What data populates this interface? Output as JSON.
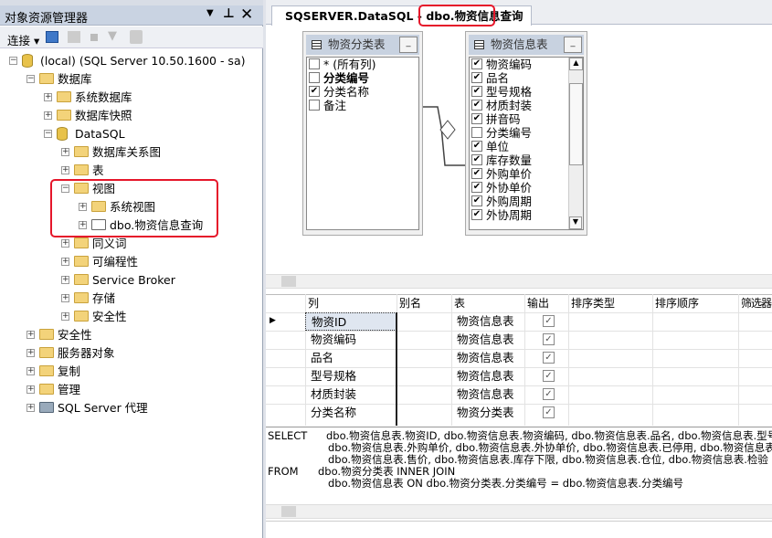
{
  "explorer": {
    "title": "对象资源管理器",
    "connect_label": "连接",
    "tree": [
      {
        "label": "(local) (SQL Server 10.50.1600 - sa)",
        "level": 0,
        "expanded": true,
        "icon": "server-icon"
      },
      {
        "label": "数据库",
        "level": 1,
        "expanded": true,
        "icon": "folder-icon"
      },
      {
        "label": "系统数据库",
        "level": 2,
        "expanded": false,
        "icon": "folder-icon"
      },
      {
        "label": "数据库快照",
        "level": 2,
        "expanded": false,
        "icon": "folder-icon"
      },
      {
        "label": "DataSQL",
        "level": 2,
        "expanded": true,
        "icon": "database-icon"
      },
      {
        "label": "数据库关系图",
        "level": 3,
        "expanded": false,
        "icon": "folder-icon"
      },
      {
        "label": "表",
        "level": 3,
        "expanded": false,
        "icon": "folder-icon"
      },
      {
        "label": "视图",
        "level": 3,
        "expanded": true,
        "icon": "folder-icon"
      },
      {
        "label": "系统视图",
        "level": 4,
        "expanded": false,
        "icon": "folder-icon"
      },
      {
        "label": "dbo.物资信息查询",
        "level": 4,
        "expanded": false,
        "icon": "view-icon"
      },
      {
        "label": "同义词",
        "level": 3,
        "expanded": false,
        "icon": "folder-icon"
      },
      {
        "label": "可编程性",
        "level": 3,
        "expanded": false,
        "icon": "folder-icon"
      },
      {
        "label": "Service Broker",
        "level": 3,
        "expanded": false,
        "icon": "folder-icon"
      },
      {
        "label": "存储",
        "level": 3,
        "expanded": false,
        "icon": "folder-icon"
      },
      {
        "label": "安全性",
        "level": 3,
        "expanded": false,
        "icon": "folder-icon"
      },
      {
        "label": "安全性",
        "level": 1,
        "expanded": false,
        "icon": "folder-icon"
      },
      {
        "label": "服务器对象",
        "level": 1,
        "expanded": false,
        "icon": "folder-icon"
      },
      {
        "label": "复制",
        "level": 1,
        "expanded": false,
        "icon": "folder-icon"
      },
      {
        "label": "管理",
        "level": 1,
        "expanded": false,
        "icon": "folder-icon"
      },
      {
        "label": "SQL Server 代理",
        "level": 1,
        "expanded": false,
        "icon": "agent-icon"
      }
    ]
  },
  "tab": {
    "title": "SQSERVER.DataSQL - dbo.物资信息查询"
  },
  "diagram": {
    "tables": [
      {
        "name": "物资分类表",
        "columns": [
          {
            "name": "* (所有列)",
            "checked": false,
            "bold": false
          },
          {
            "name": "分类编号",
            "checked": false,
            "bold": true
          },
          {
            "name": "分类名称",
            "checked": true,
            "bold": false
          },
          {
            "name": "备注",
            "checked": false,
            "bold": false
          }
        ]
      },
      {
        "name": "物资信息表",
        "columns": [
          {
            "name": "物资编码",
            "checked": true
          },
          {
            "name": "品名",
            "checked": true
          },
          {
            "name": "型号规格",
            "checked": true
          },
          {
            "name": "材质封装",
            "checked": true
          },
          {
            "name": "拼音码",
            "checked": true
          },
          {
            "name": "分类编号",
            "checked": false
          },
          {
            "name": "单位",
            "checked": true
          },
          {
            "name": "库存数量",
            "checked": true
          },
          {
            "name": "外购单价",
            "checked": true
          },
          {
            "name": "外协单价",
            "checked": true
          },
          {
            "name": "外购周期",
            "checked": true
          },
          {
            "name": "外协周期",
            "checked": true
          }
        ]
      }
    ]
  },
  "grid": {
    "headers": [
      "列",
      "别名",
      "表",
      "输出",
      "排序类型",
      "排序顺序",
      "筛选器"
    ],
    "rows": [
      {
        "column": "物资ID",
        "alias": "",
        "table": "物资信息表",
        "output": true
      },
      {
        "column": "物资编码",
        "alias": "",
        "table": "物资信息表",
        "output": true
      },
      {
        "column": "品名",
        "alias": "",
        "table": "物资信息表",
        "output": true
      },
      {
        "column": "型号规格",
        "alias": "",
        "table": "物资信息表",
        "output": true
      },
      {
        "column": "材质封装",
        "alias": "",
        "table": "物资信息表",
        "output": true
      },
      {
        "column": "分类名称",
        "alias": "",
        "table": "物资分类表",
        "output": true
      }
    ]
  },
  "sql": {
    "lines": [
      {
        "kw": "SELECT",
        "text": "dbo.物资信息表.物资ID, dbo.物资信息表.物资编码, dbo.物资信息表.品名, dbo.物资信息表.型号规"
      },
      {
        "kw": "",
        "text": "dbo.物资信息表.外购单价, dbo.物资信息表.外协单价, dbo.物资信息表.已停用, dbo.物资信息表"
      },
      {
        "kw": "",
        "text": "dbo.物资信息表.售价, dbo.物资信息表.库存下限, dbo.物资信息表.仓位, dbo.物资信息表.检验"
      },
      {
        "kw": "FROM",
        "text": "dbo.物资分类表 INNER JOIN"
      },
      {
        "kw": "",
        "text": "dbo.物资信息表 ON dbo.物资分类表.分类编号 = dbo.物资信息表.分类编号"
      }
    ]
  },
  "colors": {
    "highlight": "#e5162a",
    "panel_header": "#c9d3e2"
  }
}
